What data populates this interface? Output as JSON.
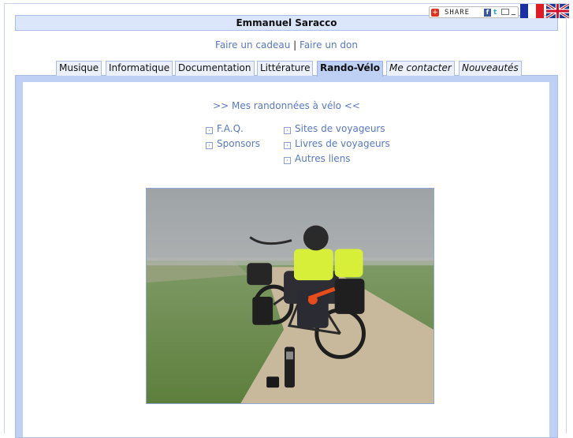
{
  "header": {
    "site_title": "Emmanuel Saracco",
    "share_label": "SHARE"
  },
  "sub_links": {
    "gift": "Faire un cadeau",
    "separator": "|",
    "donate": "Faire un don"
  },
  "tabs": [
    {
      "label": "Musique"
    },
    {
      "label": "Informatique"
    },
    {
      "label": "Documentation"
    },
    {
      "label": "Littérature"
    },
    {
      "label": "Rando-Vélo",
      "active": true
    },
    {
      "label": "Me contacter"
    },
    {
      "label": "Nouveautés"
    }
  ],
  "content": {
    "section_link": ">> Mes randonnées à vélo <<",
    "left_links": [
      "F.A.Q.",
      "Sponsors"
    ],
    "right_links": [
      "Sites de voyageurs",
      "Livres de voyageurs",
      "Autres liens"
    ]
  },
  "colors": {
    "title_bar_bg": "#dbe6fb",
    "panel_bg": "#bed0f3",
    "link": "#5878c0"
  },
  "icons": {
    "share": "plus-icon",
    "facebook": "facebook-icon",
    "twitter": "twitter-icon",
    "email": "email-icon",
    "lang_fr": "flag-fr-icon",
    "lang_en": "flag-uk-icon",
    "bullet": "arrow-bullet-icon"
  }
}
